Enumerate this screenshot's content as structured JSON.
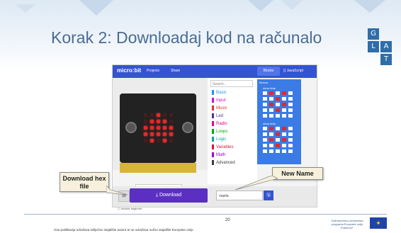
{
  "slide": {
    "title": "Korak 2: Downloadaj kod na računalo",
    "page_number": "20",
    "footer_text": "Ova publikacija odražava isključivo stajalište autora te ne odražava nužno stajalište Europske unije.",
    "eu_text": "Sufinancirano sredstvima programa Europske unije Erasmus+",
    "logo_letters": [
      "G",
      "L",
      "A",
      "T"
    ]
  },
  "makecode": {
    "logo": "micro:bit",
    "projects": "Projects",
    "share": "Share",
    "blocks_tab": "Blocks",
    "js_tab": "{} JavaScript",
    "search_placeholder": "Search...",
    "toolbox": [
      {
        "label": "Basic",
        "color": "#1e90ff"
      },
      {
        "label": "Input",
        "color": "#d400d4"
      },
      {
        "label": "Music",
        "color": "#e63022"
      },
      {
        "label": "Led",
        "color": "#5c2d91"
      },
      {
        "label": "Radio",
        "color": "#e3008c"
      },
      {
        "label": "Loops",
        "color": "#00aa00"
      },
      {
        "label": "Logic",
        "color": "#00a4a6"
      },
      {
        "label": "Variables",
        "color": "#dc143c"
      },
      {
        "label": "Math",
        "color": "#9400d3"
      },
      {
        "label": "Advanced",
        "color": "#3c3c3c"
      }
    ],
    "forever_label": "forever",
    "show_leds_label": "show leds",
    "download_label": "Download",
    "name_value": "nepita",
    "checkbox_label": "Include beginner"
  },
  "callouts": {
    "download_hex": "Download hex file",
    "new_name": "New Name"
  },
  "colors": {
    "title": "#4a6b93",
    "accent": "#3454d1",
    "download": "#5a2fc2"
  }
}
